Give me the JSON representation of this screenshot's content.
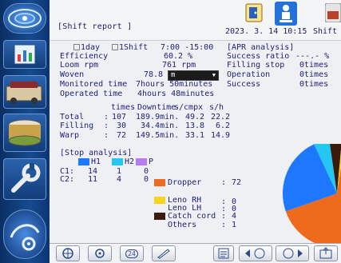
{
  "header": {
    "title": "[Shift report ]",
    "date": "2023. 3. 14 10:15",
    "shift": "Shift"
  },
  "period": {
    "day_label": "1day",
    "shift_label": "1Shift",
    "time_range": "7:00 -15:00"
  },
  "stats": {
    "efficiency_label": "Efficiency",
    "efficiency_value": "60.2 %",
    "loom_rpm_label": "Loom rpm",
    "loom_rpm_value": "761 rpm",
    "woven_label": "Woven",
    "woven_value": "78.8",
    "woven_unit": "m",
    "monitored_label": "Monitored time",
    "monitored_value": "7hours 50minutes",
    "operated_label": "Operated time",
    "operated_value": "4hours 48minutes"
  },
  "apr": {
    "title": "[APR analysis]",
    "rows": [
      {
        "label": "Success ratio",
        "value": "---.- %"
      },
      {
        "label": "Filling stop",
        "value": "0times"
      },
      {
        "label": "Operation",
        "value": "0times"
      },
      {
        "label": "Success",
        "value": "0times"
      }
    ]
  },
  "stops_table": {
    "headers": [
      "times",
      "Downtime",
      "s/cmpx",
      "s/h"
    ],
    "rows": [
      {
        "label": "Total",
        "times": "107",
        "downtime": "189.9min.",
        "s_cmpx": "49.2",
        "s_h": "22.2"
      },
      {
        "label": "Filling",
        "times": "30",
        "downtime": "34.4min.",
        "s_cmpx": "13.8",
        "s_h": "6.2"
      },
      {
        "label": "Warp",
        "times": "72",
        "downtime": "149.5min.",
        "s_cmpx": "33.1",
        "s_h": "14.9"
      }
    ]
  },
  "stop_analysis": {
    "title": "[Stop analysis]",
    "heads": [
      {
        "name": "H1",
        "color": "#1e78ff"
      },
      {
        "name": "H2",
        "color": "#23c7f2"
      },
      {
        "name": "P",
        "color": "#b77cf2"
      }
    ],
    "rows": [
      {
        "label": "C1:",
        "values": [
          "14",
          "1",
          "0"
        ]
      },
      {
        "label": "C2:",
        "values": [
          "11",
          "4",
          "0"
        ]
      }
    ],
    "legend": [
      {
        "label": "Dropper",
        "value": "72",
        "color": "#ee6a1c"
      },
      {
        "label": "Leno RH",
        "value": "0",
        "color": "#f5d51e"
      },
      {
        "label": "Leno LH",
        "value": "0",
        "color": ""
      },
      {
        "label": "Catch cord",
        "value": "4",
        "color": "#3a1a0a"
      },
      {
        "label": "Others",
        "value": "1",
        "color": ""
      }
    ],
    "pie": [
      {
        "name": "Dropper",
        "value": 72,
        "color": "#ee6a1c"
      },
      {
        "name": "H1",
        "value": 25,
        "color": "#1e78ff"
      },
      {
        "name": "H2",
        "value": 5,
        "color": "#23c7f2"
      },
      {
        "name": "Catch cord",
        "value": 4,
        "color": "#3a1a0a"
      },
      {
        "name": "Others",
        "value": 1,
        "color": "#f5d51e"
      }
    ]
  },
  "toolbar": {
    "btn_count": "24"
  },
  "colon": ":"
}
